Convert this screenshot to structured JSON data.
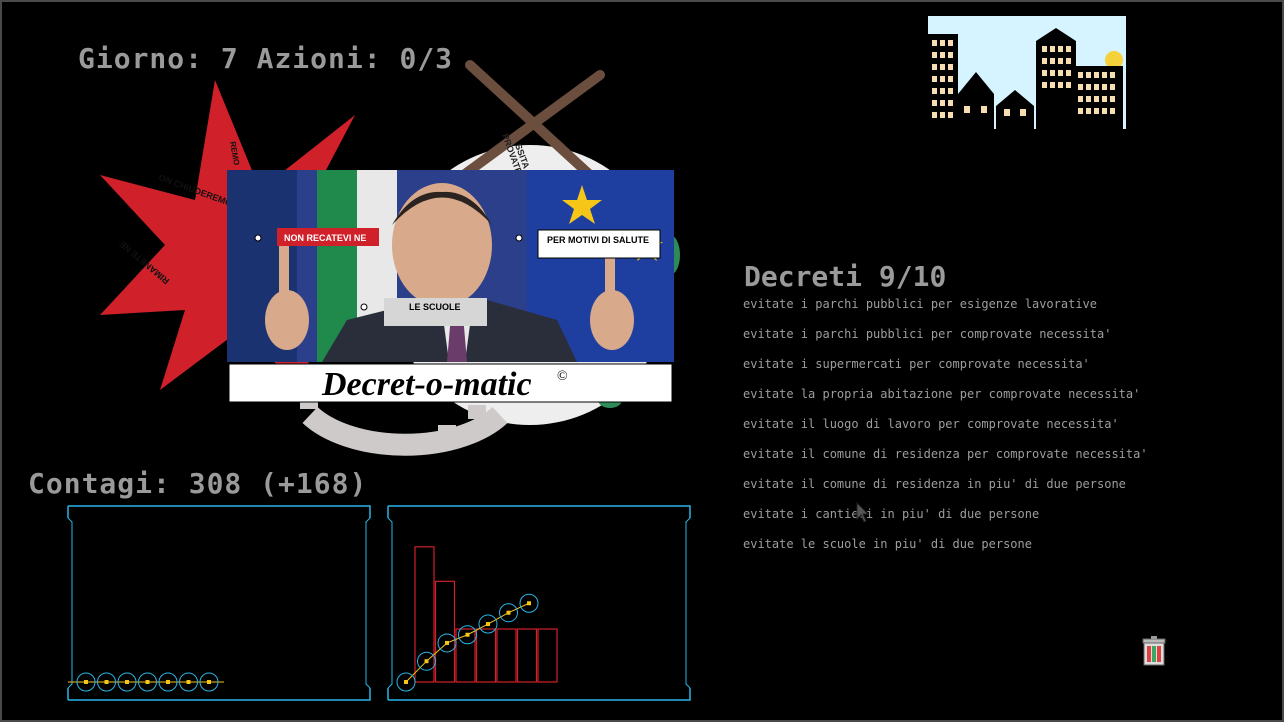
{
  "hud": {
    "giorno_label": "Giorno:",
    "giorno": 7,
    "azioni_label": "Azioni:",
    "azioni": "0/3",
    "contagi_label": "Contagi:",
    "contagi": 308,
    "contagi_delta": "(+168)"
  },
  "poster": {
    "title": "Decret-o-matic",
    "copyright": "©",
    "bubbles": [
      "NON RECATEVI NE",
      "PER MOTIVI DI SALUTE",
      "LE SCUOLE"
    ]
  },
  "badges": {
    "star_texts": [
      "ON CHIUDEREMO",
      "RIMANETE NE",
      "REMO"
    ],
    "seal_texts": [
      "PROVATE",
      "SSITA"
    ]
  },
  "decreti": {
    "label": "Decreti",
    "count": "9/10",
    "items": [
      "evitate i parchi pubblici per esigenze lavorative",
      "evitate i parchi pubblici per comprovate necessita'",
      "evitate i supermercati per comprovate necessita'",
      "evitate la propria abitazione per comprovate necessita'",
      "evitate il luogo di lavoro per comprovate necessita'",
      "evitate il comune di residenza per comprovate necessita'",
      "evitate il comune di residenza in piu' di due persone",
      "evitate i cantieri in piu' di due persone",
      "evitate le scuole in piu' di due persone"
    ]
  },
  "colors": {
    "red": "#d0202a",
    "cyan": "#29b6e8",
    "yellow": "#f5c518",
    "gray_text": "#9a9a9a"
  },
  "chart_data": [
    {
      "type": "line",
      "series": [
        {
          "values": [
            0,
            0,
            0,
            0,
            0,
            0,
            0
          ]
        }
      ]
    },
    {
      "type": "bar",
      "bars": [
        255,
        190,
        100,
        100,
        100,
        100,
        100
      ],
      "line": [
        0,
        33,
        62,
        75,
        92,
        110,
        125
      ]
    }
  ],
  "icons": {
    "trash": "trash-can-icon",
    "cursor": "mouse-pointer-icon"
  }
}
